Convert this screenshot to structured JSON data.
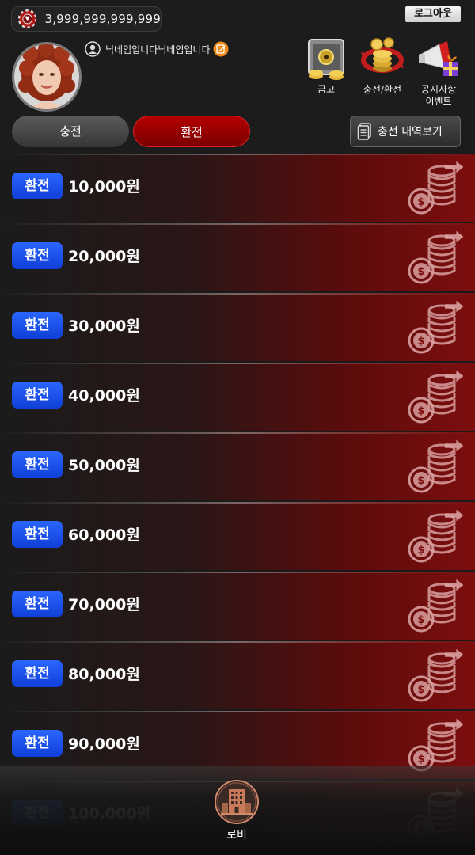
{
  "header": {
    "balance": "3,999,999,999,999",
    "logout_label": "로그아웃",
    "nickname": "닉네임입니다닉네임입니다",
    "menu": [
      {
        "label": "금고",
        "icon": "safe-icon"
      },
      {
        "label": "충전/환전",
        "icon": "coin-exchange-icon"
      },
      {
        "label": "공지사항",
        "label2": "이벤트",
        "icon": "megaphone-gift-icon"
      }
    ],
    "tabs": {
      "charge": "충전",
      "exchange": "환전",
      "active": "exchange"
    },
    "history_label": "충전 내역보기"
  },
  "list": {
    "rows": [
      {
        "badge": "환전",
        "amount": "10,000원"
      },
      {
        "badge": "환전",
        "amount": "20,000원"
      },
      {
        "badge": "환전",
        "amount": "30,000원"
      },
      {
        "badge": "환전",
        "amount": "40,000원"
      },
      {
        "badge": "환전",
        "amount": "50,000원"
      },
      {
        "badge": "환전",
        "amount": "60,000원"
      },
      {
        "badge": "환전",
        "amount": "70,000원"
      },
      {
        "badge": "환전",
        "amount": "80,000원"
      },
      {
        "badge": "환전",
        "amount": "90,000원"
      },
      {
        "badge": "환전",
        "amount": "100,000원"
      }
    ]
  },
  "bottom_nav": {
    "lobby_label": "로비"
  },
  "colors": {
    "accent_red": "#b40000",
    "badge_blue": "#1e52f0",
    "background": "#1a1a1a"
  }
}
